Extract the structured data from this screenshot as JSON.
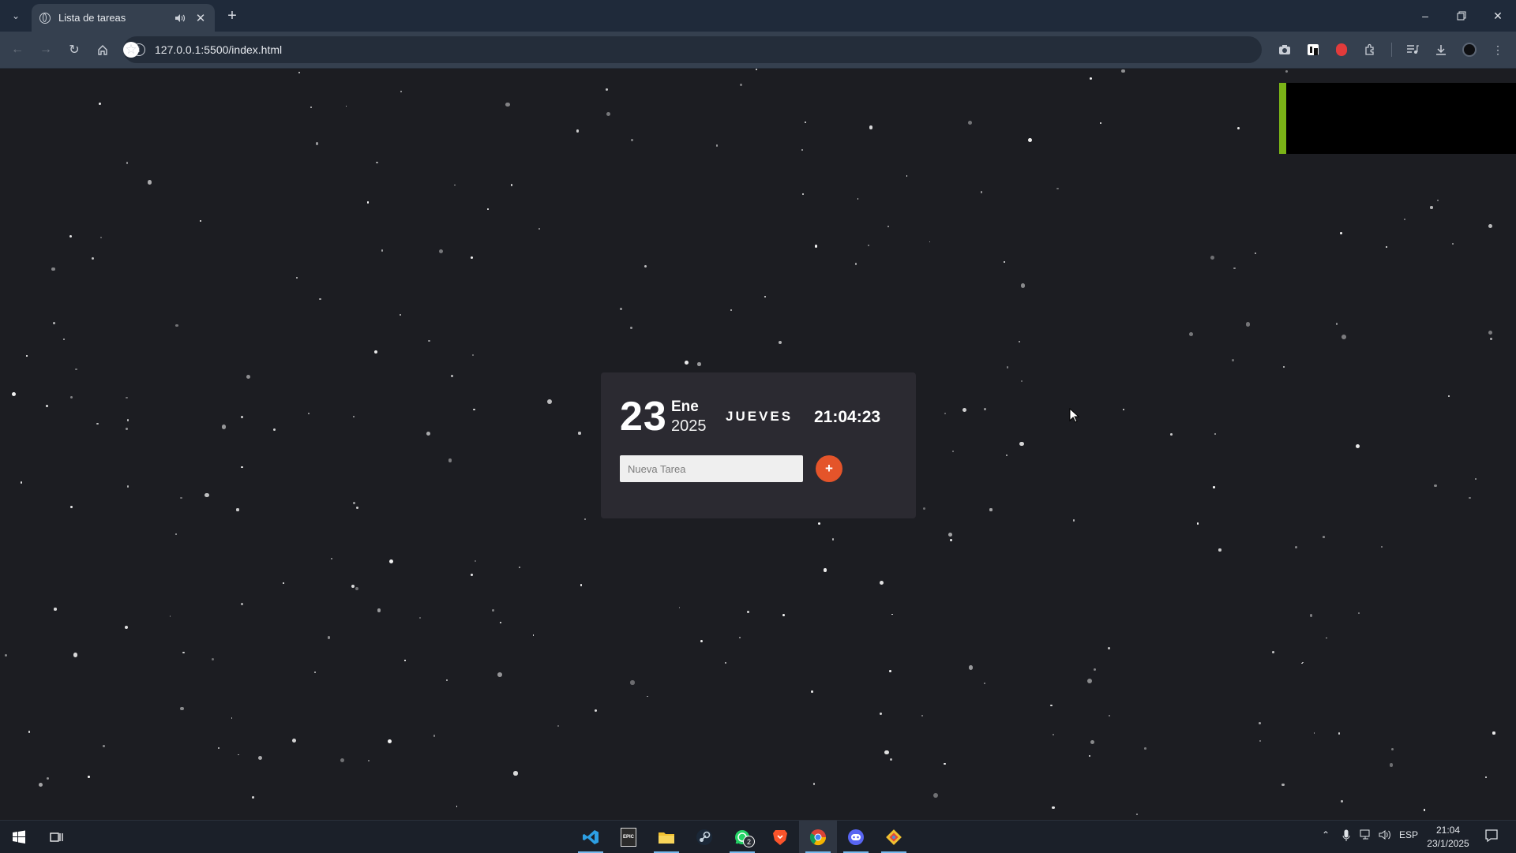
{
  "browser": {
    "tab_title": "Lista de tareas",
    "new_tab_label": "+",
    "url": "127.0.0.1:5500/index.html",
    "window_controls": [
      "minimize-icon",
      "restore-icon",
      "close-icon"
    ],
    "accent_color": "#35404f"
  },
  "widget": {
    "day": "23",
    "month": "Ene",
    "year": "2025",
    "weekday": "JUEVES",
    "time": "21:04:23",
    "input_placeholder": "Nueva Tarea",
    "input_value": "",
    "add_button_label": "+",
    "add_button_color": "#e4542a"
  },
  "corner_box": {
    "accent_color": "#7ab317"
  },
  "taskbar": {
    "apps": [
      {
        "name": "vscode-icon",
        "active": true
      },
      {
        "name": "epic-games-icon",
        "active": false
      },
      {
        "name": "file-explorer-icon",
        "active": true
      },
      {
        "name": "steam-icon",
        "active": false
      },
      {
        "name": "whatsapp-icon",
        "active": true,
        "badge": "2"
      },
      {
        "name": "brave-icon",
        "active": false
      },
      {
        "name": "chrome-icon",
        "active": true
      },
      {
        "name": "discord-icon",
        "active": true
      },
      {
        "name": "git-icon",
        "active": true
      }
    ],
    "whatsapp_badge": "2",
    "language": "ESP",
    "time": "21:04",
    "date": "23/1/2025",
    "epic_label": "EPIC"
  }
}
